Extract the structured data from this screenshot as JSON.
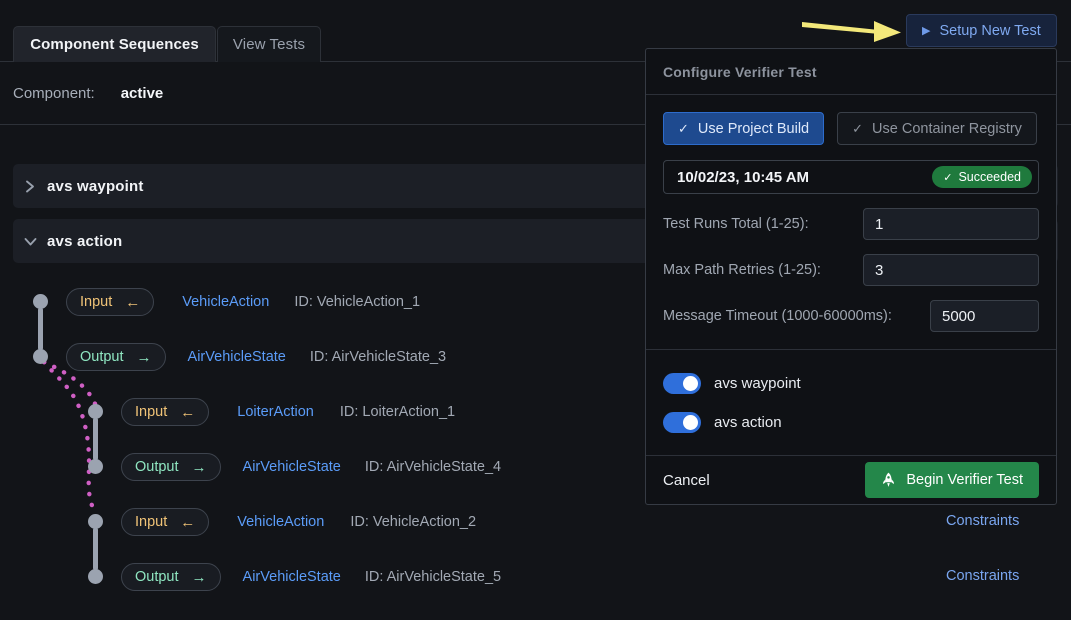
{
  "tabs": [
    {
      "id": "component-sequences",
      "label": "Component Sequences",
      "active": true
    },
    {
      "id": "view-tests",
      "label": "View Tests",
      "active": false
    }
  ],
  "component_header": {
    "label": "Component:",
    "value": "active"
  },
  "setup_button": {
    "label": "Setup New Test",
    "icon": "play-triangle-icon"
  },
  "annotation": {
    "arrow_icon": "yellow-arrow-pointer",
    "arrow_color": "#f3e87a"
  },
  "groups": [
    {
      "id": "avs-waypoint",
      "title": "avs waypoint",
      "expanded": false,
      "chevron": "chevron-right-icon"
    },
    {
      "id": "avs-action",
      "title": "avs action",
      "expanded": true,
      "chevron": "chevron-down-icon"
    }
  ],
  "sequence_rows": [
    {
      "direction": "Input",
      "arrow": "←",
      "type": "VehicleAction",
      "id_text": "ID: VehicleAction_1",
      "indent": 0,
      "constraints": null
    },
    {
      "direction": "Output",
      "arrow": "→",
      "type": "AirVehicleState",
      "id_text": "ID: AirVehicleState_3",
      "indent": 0,
      "constraints": null
    },
    {
      "direction": "Input",
      "arrow": "←",
      "type": "LoiterAction",
      "id_text": "ID: LoiterAction_1",
      "indent": 1,
      "constraints": null
    },
    {
      "direction": "Output",
      "arrow": "→",
      "type": "AirVehicleState",
      "id_text": "ID: AirVehicleState_4",
      "indent": 1,
      "constraints": null
    },
    {
      "direction": "Input",
      "arrow": "←",
      "type": "VehicleAction",
      "id_text": "ID: VehicleAction_2",
      "indent": 1,
      "constraints": "Constraints"
    },
    {
      "direction": "Output",
      "arrow": "→",
      "type": "AirVehicleState",
      "id_text": "ID: AirVehicleState_5",
      "indent": 1,
      "constraints": "Constraints"
    }
  ],
  "dialog": {
    "title": "Configure Verifier Test",
    "source_options": [
      {
        "id": "use-project-build",
        "label": "Use Project Build",
        "selected": true,
        "icon": "check-icon"
      },
      {
        "id": "use-container-registry",
        "label": "Use Container Registry",
        "selected": false,
        "icon": "check-icon"
      }
    ],
    "build": {
      "date": "10/02/23, 10:45 AM",
      "status": "Succeeded",
      "status_icon": "check-icon",
      "status_color": "#1f7a3d"
    },
    "fields": [
      {
        "id": "test-runs-total",
        "label": "Test Runs Total (1-25):",
        "value": "1"
      },
      {
        "id": "max-path-retries",
        "label": "Max Path Retries (1-25):",
        "value": "3"
      },
      {
        "id": "message-timeout",
        "label": "Message Timeout (1000-60000ms):",
        "value": "5000"
      }
    ],
    "toggles": [
      {
        "id": "avs-waypoint",
        "label": "avs waypoint",
        "on": true
      },
      {
        "id": "avs-action",
        "label": "avs action",
        "on": true
      }
    ],
    "footer": {
      "cancel_label": "Cancel",
      "submit_label": "Begin Verifier Test",
      "submit_icon": "rocket-icon",
      "submit_color": "#24874a"
    }
  },
  "colors": {
    "page_bg": "#121418",
    "row_bg": "#1c1f26",
    "accent_blue": "#5b9cf8",
    "input_amber": "#f0c377",
    "output_mint": "#8fe6c1",
    "toggle_on": "#2f6fdb",
    "dot_gray": "#9ba3b0",
    "path_magenta": "#cf5fc4"
  }
}
